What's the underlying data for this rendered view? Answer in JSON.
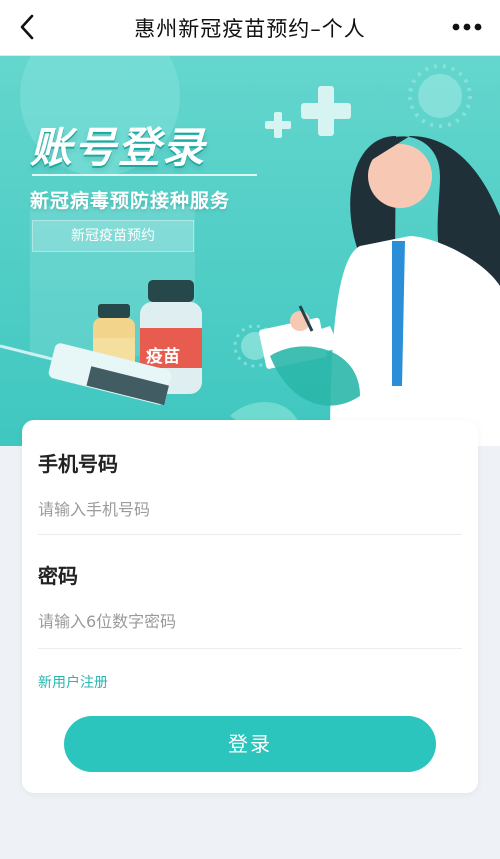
{
  "navbar": {
    "title": "惠州新冠疫苗预约–个人",
    "back_icon": "chevron-left-icon",
    "more_icon": "more-dots-icon"
  },
  "banner": {
    "title": "账号登录",
    "subtitle": "新冠病毒预防接种服务",
    "tag": "新冠疫苗预约",
    "jar_label": "疫苗",
    "colors": {
      "background": "#5fd3cb",
      "accent": "#2cc5bd"
    }
  },
  "form": {
    "phone": {
      "label": "手机号码",
      "placeholder": "请输入手机号码",
      "value": ""
    },
    "password": {
      "label": "密码",
      "placeholder": "请输入6位数字密码",
      "value": ""
    },
    "register_link": "新用户注册",
    "login_button": "登录"
  }
}
